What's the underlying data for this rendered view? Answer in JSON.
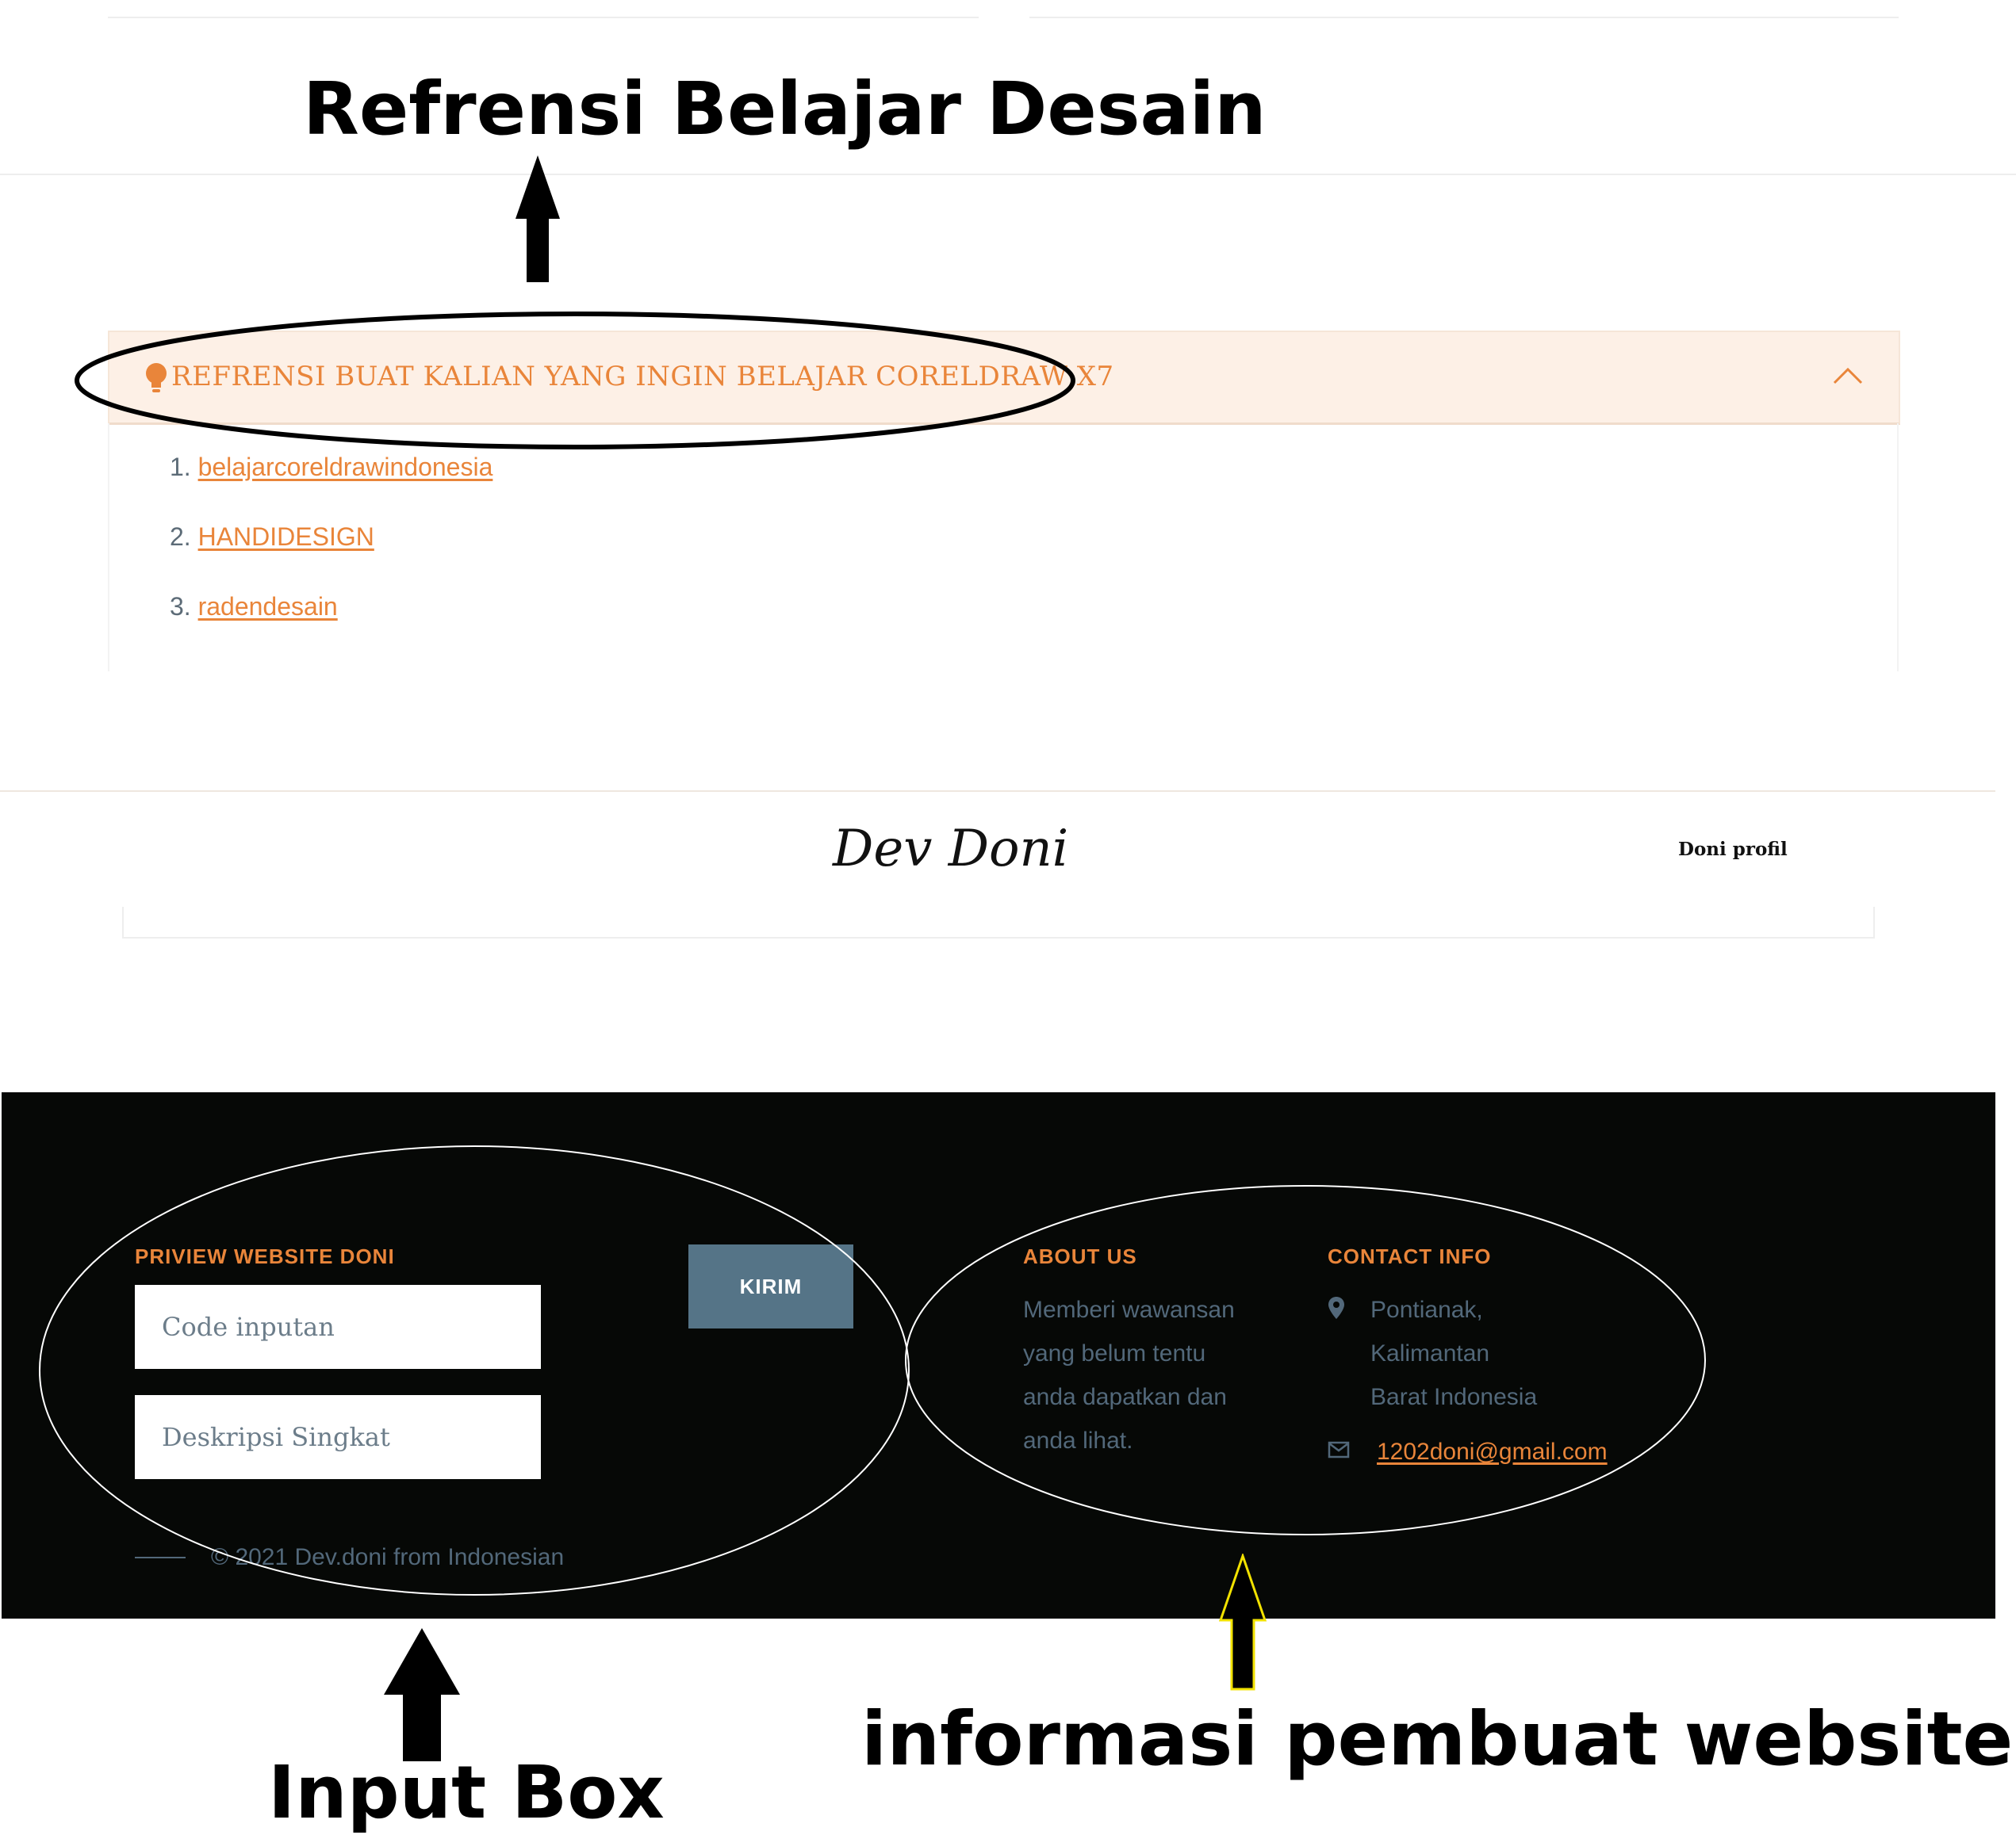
{
  "annotations": {
    "top_label": "Refrensi Belajar Desain",
    "input_label": "Input Box",
    "info_label": "informasi pembuat website"
  },
  "accordion": {
    "icon": "lightbulb-icon",
    "title": "REFRENSI BUAT KALIAN YANG INGIN BELAJAR CORELDRAW X7",
    "toggle_icon": "chevron-up-icon",
    "items": [
      {
        "number": "1.",
        "label": "belajarcoreldrawindonesia"
      },
      {
        "number": "2.",
        "label": "HANDIDESIGN"
      },
      {
        "number": "3.",
        "label": "radendesain"
      }
    ]
  },
  "header": {
    "brand": "Dev Doni",
    "nav_profile": "Doni profil"
  },
  "footer": {
    "preview_title": "PRIVIEW WEBSITE DONI",
    "code_placeholder": "Code inputan",
    "desc_placeholder": "Deskripsi Singkat",
    "submit_label": "KIRIM",
    "copyright": "© 2021 Dev.doni from Indonesian",
    "about": {
      "title": "ABOUT US",
      "lines": [
        "Memberi wawansan",
        "yang belum tentu",
        "anda dapatkan dan",
        "anda lihat."
      ]
    },
    "contact": {
      "title": "CONTACT INFO",
      "address_icon": "map-pin-icon",
      "address_lines": [
        "Pontianak,",
        "Kalimantan",
        "Barat Indonesia"
      ],
      "email_icon": "envelope-icon",
      "email": "1202doni@gmail.com"
    }
  },
  "colors": {
    "accent": "#e9853a",
    "accordion_bg": "#fdf0e6",
    "footer_bg": "#060806",
    "button_bg": "#557487",
    "muted_text": "#52687a"
  }
}
